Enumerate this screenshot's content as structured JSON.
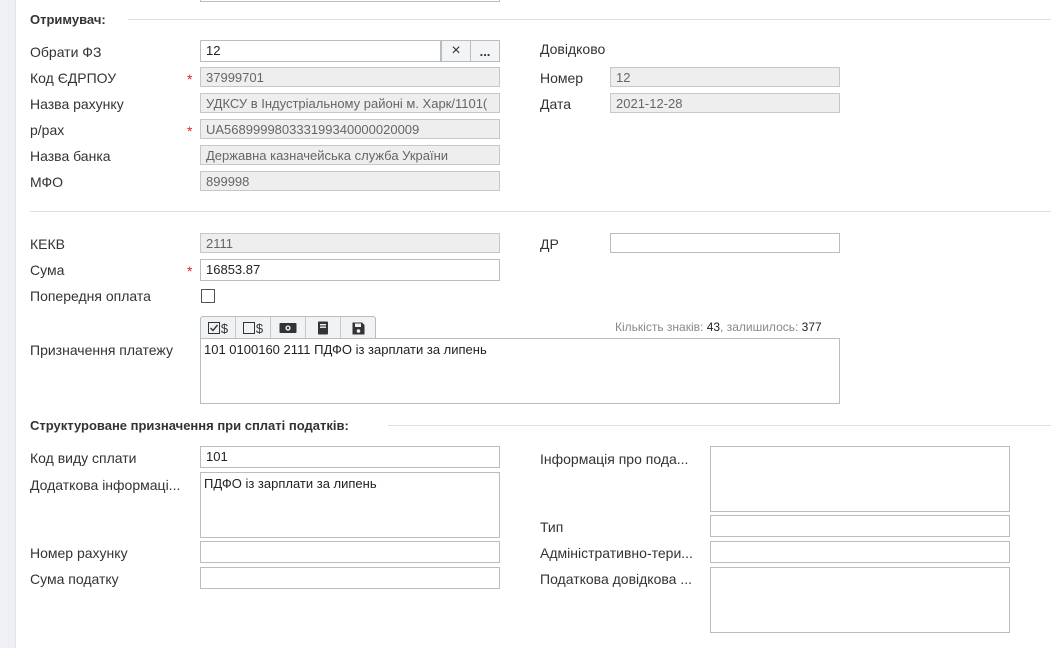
{
  "recipient": {
    "section_title": "Отримувач:",
    "choose_fz": {
      "label": "Обрати ФЗ",
      "value": "12",
      "clear": "×",
      "more": "..."
    },
    "edrpou": {
      "label": "Код ЄДРПОУ",
      "value": "37999701"
    },
    "account_name": {
      "label": "Назва рахунку",
      "value": "УДКСУ в Індустріальному районі м. Харк/1101("
    },
    "account": {
      "label": "р/рах",
      "value": "UA568999980333199340000020009"
    },
    "bank_name": {
      "label": "Назва банка",
      "value": "Державна казначейська служба України"
    },
    "mfo": {
      "label": "МФО",
      "value": "899998"
    },
    "reference": {
      "title": "Довідково",
      "number_label": "Номер",
      "number": "12",
      "date_label": "Дата",
      "date": "2021-12-28"
    }
  },
  "payment": {
    "kekv": {
      "label": "КЕКВ",
      "value": "2111"
    },
    "dr": {
      "label": "ДР",
      "value": ""
    },
    "sum": {
      "label": "Сума",
      "value": "16853.87"
    },
    "prepayment": {
      "label": "Попередня оплата",
      "checked": false
    },
    "purpose": {
      "label": "Призначення платежу",
      "value": "101 0100160 2111 ПДФО із зарплати за липень"
    },
    "counter": {
      "chars_label": "Кількість знаків:",
      "chars": "43",
      "left_label": ", залишилось:",
      "left": "377"
    },
    "toolbar": [
      {
        "name": "check-dollar-icon",
        "glyph": "☑$"
      },
      {
        "name": "box-dollar-icon",
        "glyph": "☐$"
      },
      {
        "name": "money-icon",
        "glyph": ""
      },
      {
        "name": "book-icon",
        "glyph": ""
      },
      {
        "name": "save-icon",
        "glyph": ""
      }
    ]
  },
  "tax": {
    "section_title": "Структуроване призначення при сплаті податків:",
    "payment_code": {
      "label": "Код виду сплати",
      "value": "101"
    },
    "extra_info": {
      "label": "Додаткова інформаці...",
      "value": "ПДФО із зарплати за липень"
    },
    "account_number": {
      "label": "Номер рахунку",
      "value": ""
    },
    "tax_sum": {
      "label": "Сума податку",
      "value": ""
    },
    "tax_info": {
      "label": "Інформація про пода...",
      "value": ""
    },
    "type": {
      "label": "Тип",
      "value": ""
    },
    "admin_territory": {
      "label": "Адміністративно-тери...",
      "value": ""
    },
    "tax_reference": {
      "label": "Податкова довідкова ...",
      "value": ""
    }
  },
  "colors": {
    "required": "#d9262a",
    "readonly_bg": "#eeeeee",
    "border": "#b9bcc1"
  }
}
